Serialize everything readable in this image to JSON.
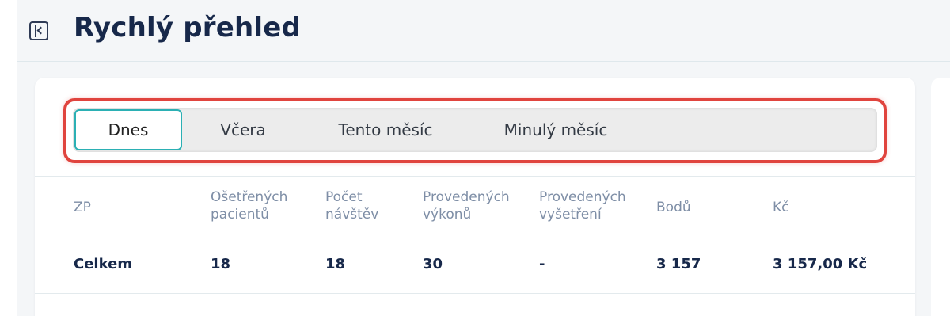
{
  "header": {
    "title": "Rychlý přehled",
    "sidebar_toggle_icon": "sidebar-collapse-icon"
  },
  "tabs": [
    {
      "label": "Dnes",
      "active": true
    },
    {
      "label": "Včera",
      "active": false
    },
    {
      "label": "Tento měsíc",
      "active": false
    },
    {
      "label": "Minulý měsíc",
      "active": false
    }
  ],
  "table": {
    "columns": [
      {
        "line1": "ZP",
        "line2": ""
      },
      {
        "line1": "Ošetřených",
        "line2": "pacientů"
      },
      {
        "line1": "Počet",
        "line2": "návštěv"
      },
      {
        "line1": "Provedených",
        "line2": "výkonů"
      },
      {
        "line1": "Provedených",
        "line2": "vyšetření"
      },
      {
        "line1": "Bodů",
        "line2": ""
      },
      {
        "line1": "Kč",
        "line2": ""
      }
    ],
    "rows": [
      [
        "Celkem",
        "18",
        "18",
        "30",
        "-",
        "3 157",
        "3 157,00 Kč"
      ]
    ]
  },
  "colors": {
    "accent": "#2bb0b4",
    "highlight": "#e0443e",
    "title": "#17284a"
  }
}
